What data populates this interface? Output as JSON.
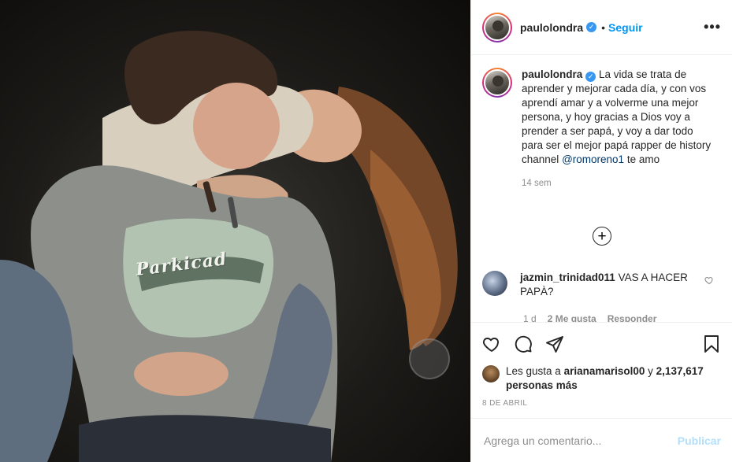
{
  "post": {
    "username": "paulolondra",
    "follow_label": "Seguir",
    "dot": "•",
    "more_label": "•••",
    "verified_glyph": "✓",
    "shirt_print": "Parkicad",
    "caption_text": "La vida se trata de aprender y mejorar cada día, y con vos aprendí amar y a volverme una mejor persona, y hoy gracias a Dios voy a prender a ser papá, y voy a dar todo para ser el mejor papá rapper de history channel",
    "caption_mention": "@romoreno1",
    "caption_end": " te amo",
    "time_ago": "14 sem",
    "load_more_glyph": "+",
    "comment": {
      "username": "jazmin_trinidad011",
      "text": "VAS A HACER PAPÀ?",
      "age": "1 d",
      "likes": "2 Me gusta",
      "reply_label": "Responder"
    },
    "likes": {
      "prefix": "Les gusta a",
      "user": "arianamarisol00",
      "joiner": "y",
      "count_text": "2,137,617 personas más"
    },
    "date": "8 DE ABRIL",
    "add_comment": {
      "placeholder": "Agrega un comentario...",
      "publish_label": "Publicar"
    },
    "icons": {
      "heart": "heart-icon",
      "comment": "comment-icon",
      "share": "share-icon",
      "save": "bookmark-icon",
      "verified": "verified-badge-icon",
      "add": "plus-circle-icon"
    },
    "colors": {
      "accent": "#0095f6",
      "verified": "#3897f0",
      "muted": "#8e8e8e",
      "publish_disabled": "#b2dffc",
      "mention": "#00376b"
    }
  }
}
